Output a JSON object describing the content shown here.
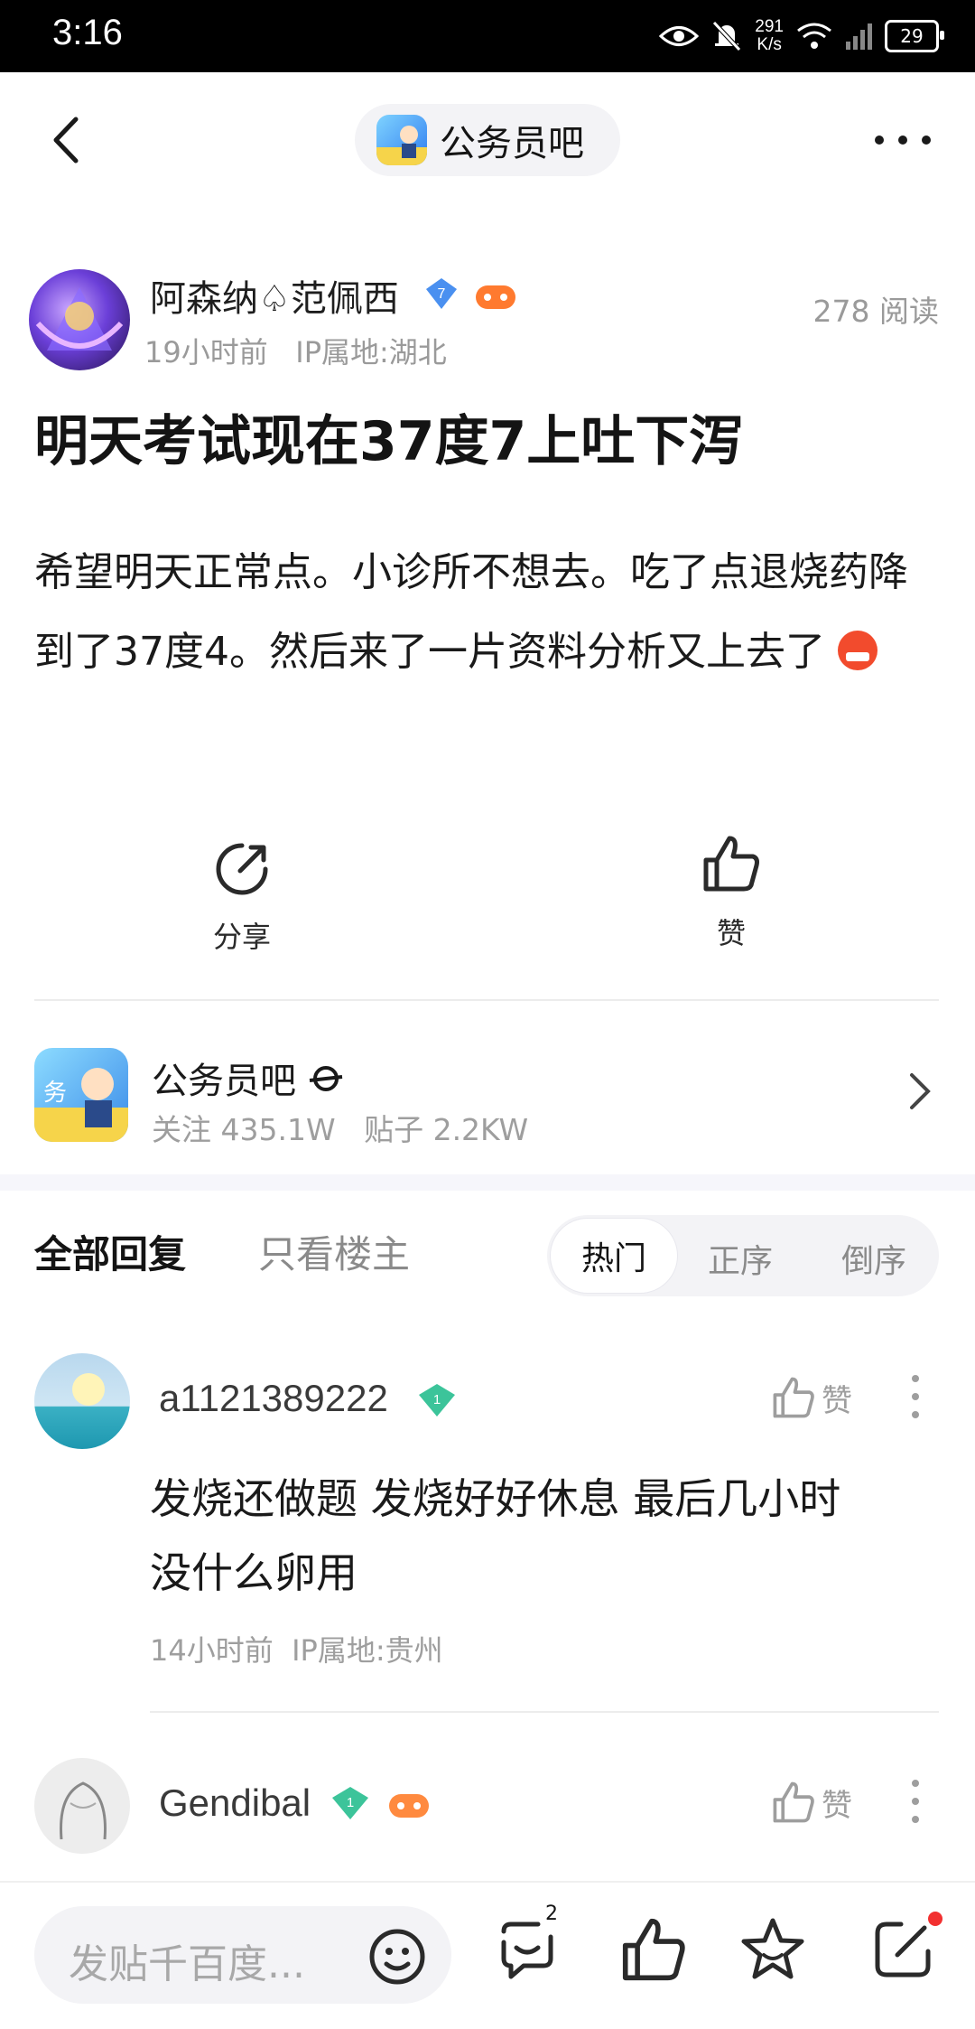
{
  "status_bar": {
    "time": "3:16",
    "net_speed_value": "291",
    "net_speed_unit": "K/s",
    "battery": "29"
  },
  "nav": {
    "forum_name": "公务员吧"
  },
  "post": {
    "author": "阿森纳♤范佩西",
    "time": "19小时前",
    "ip": "IP属地:湖北",
    "reads": "278 阅读",
    "title": "明天考试现在37度7上吐下泻",
    "body": "希望明天正常点。小诊所不想去。吃了点退烧药降到了37度4。然后来了一片资料分析又上去了"
  },
  "actions": {
    "share": "分享",
    "like": "赞"
  },
  "forum_card": {
    "name": "公务员吧",
    "followers": "关注 435.1W",
    "posts": "贴子 2.2KW"
  },
  "tabs": {
    "all": "全部回复",
    "op_only": "只看楼主"
  },
  "sort": {
    "hot": "热门",
    "asc": "正序",
    "desc": "倒序"
  },
  "comments": [
    {
      "user": "a1121389222",
      "level": "1",
      "like": "赞",
      "text_line1": "发烧还做题 发烧好好休息 最后几小时",
      "text_line2": "没什么卵用",
      "time": "14小时前",
      "ip": "IP属地:贵州"
    },
    {
      "user": "Gendibal",
      "level": "1",
      "like": "赞"
    }
  ],
  "bottom": {
    "placeholder": "发贴千百度...",
    "comment_count": "2"
  },
  "colors": {
    "accent_blue": "#4a90f0",
    "level_green": "#3cc49a",
    "red_dot": "#f23030"
  }
}
